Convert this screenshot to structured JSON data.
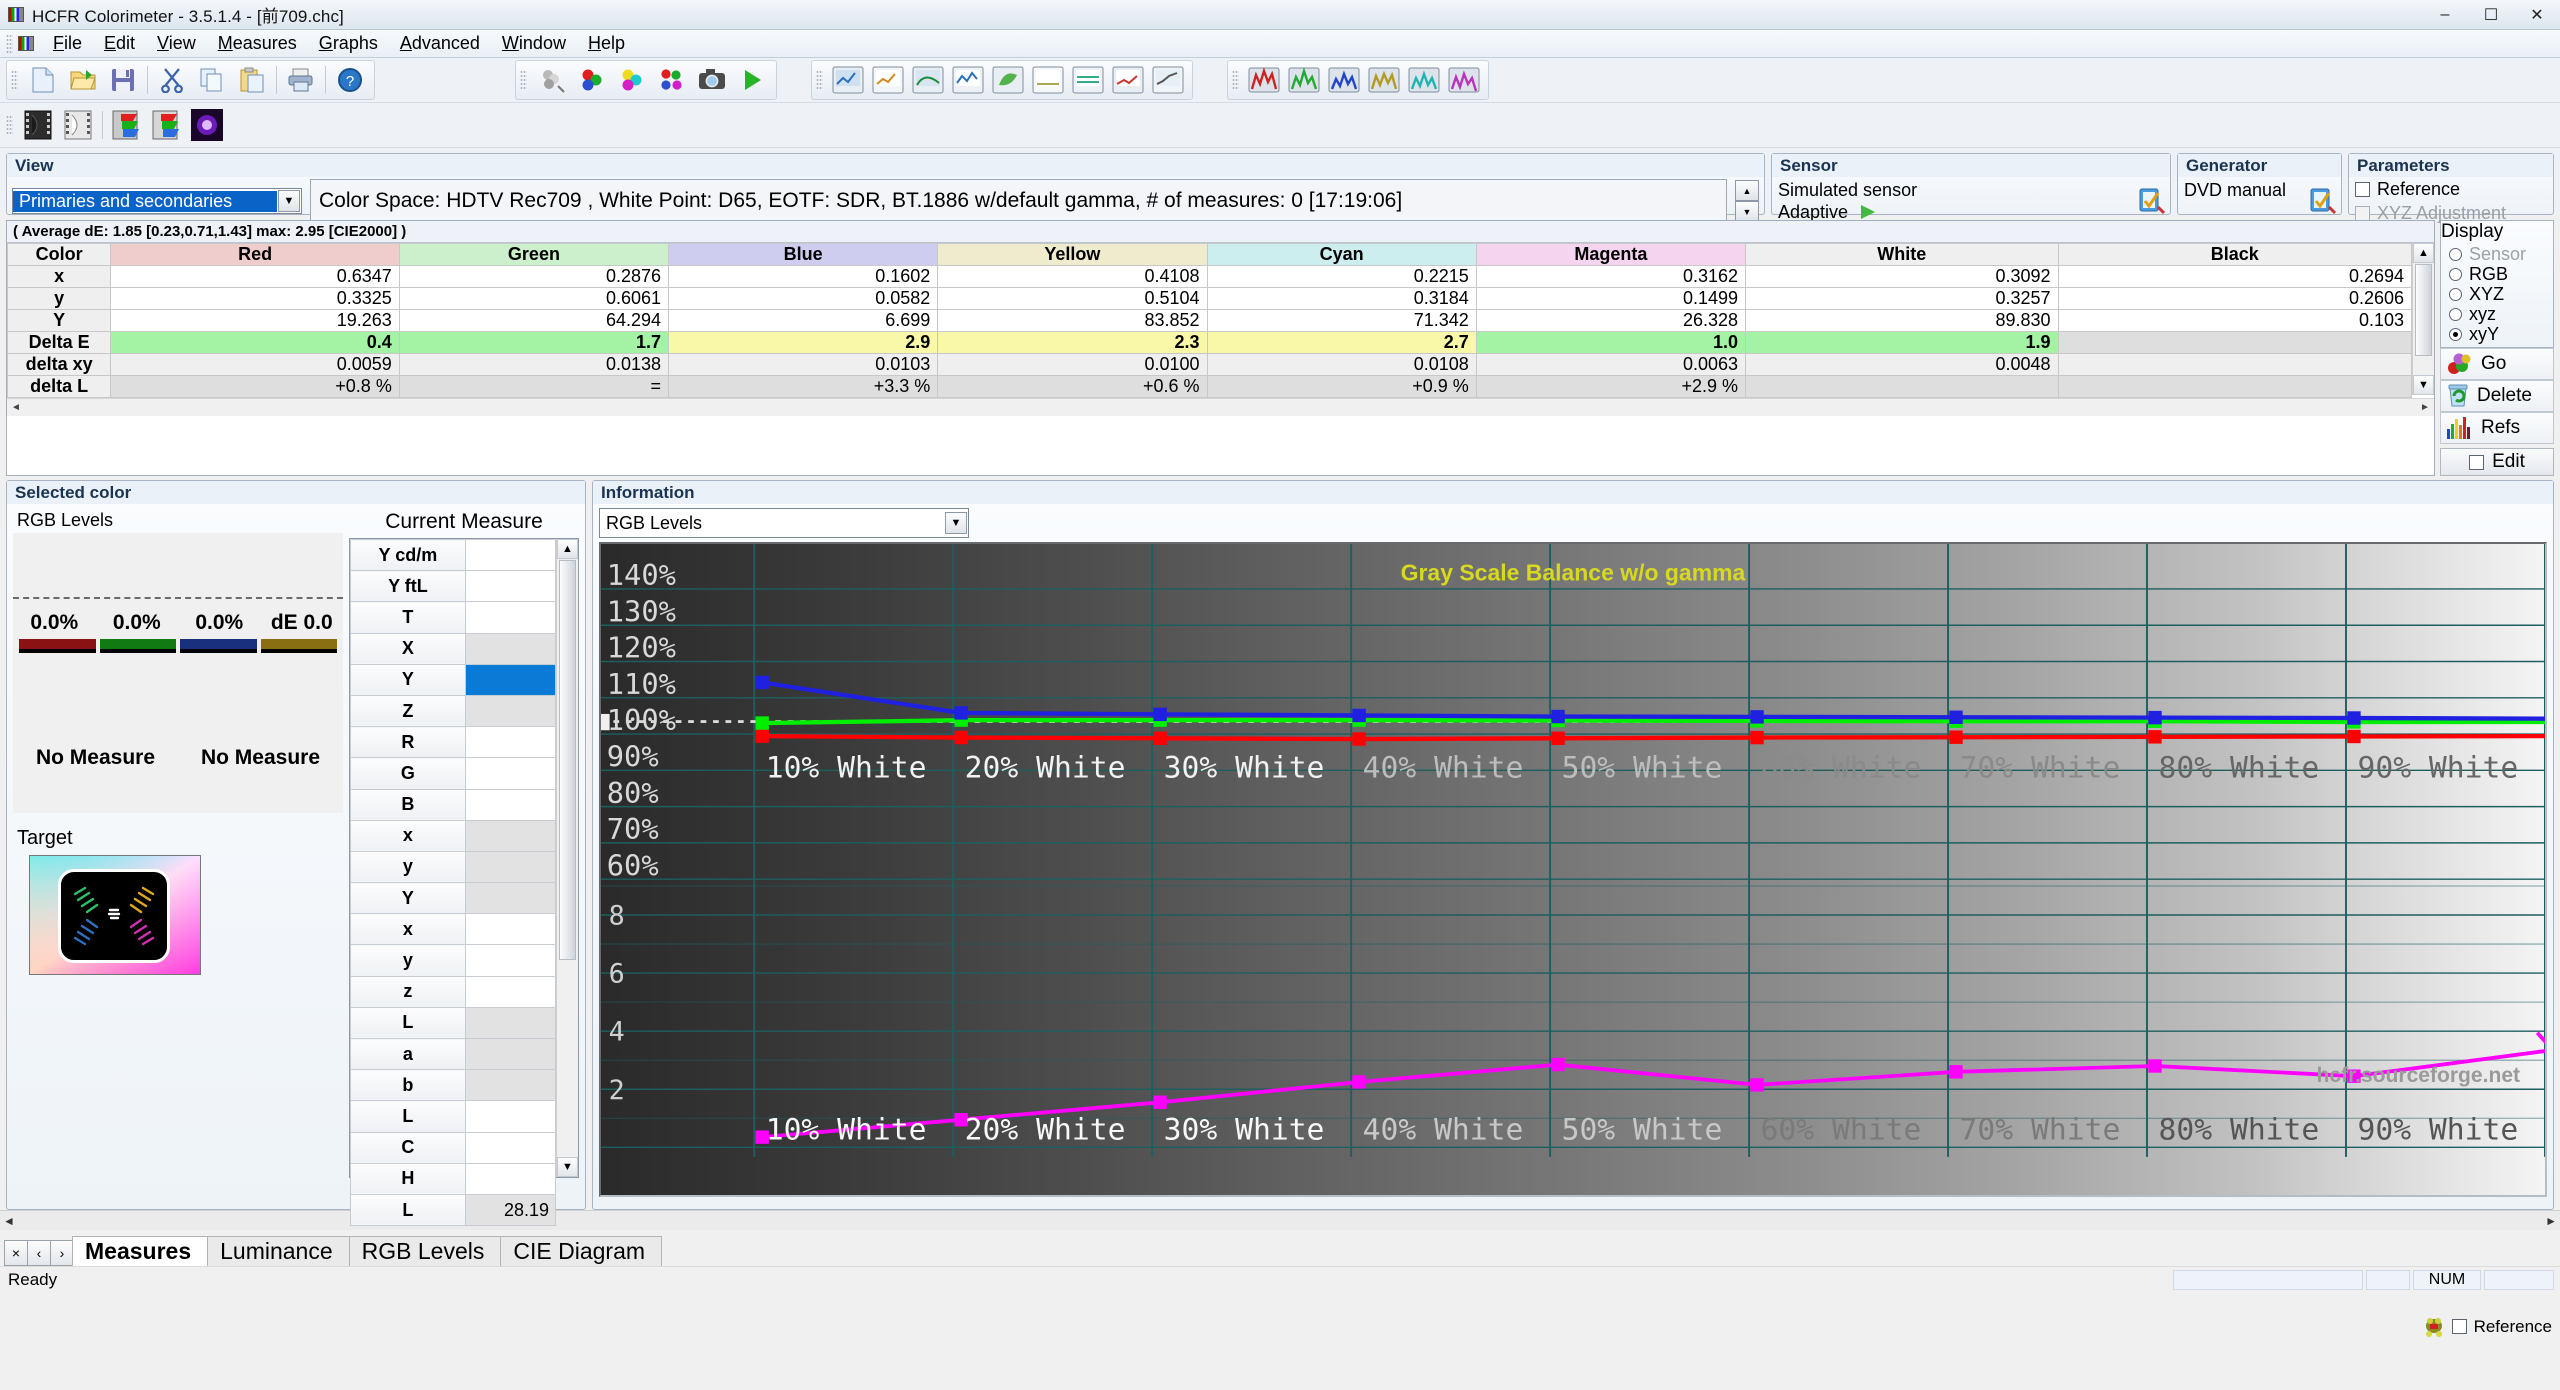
{
  "window": {
    "title": "HCFR Colorimeter - 3.5.1.4 - [前709.chc]",
    "minimize": "–",
    "maximize": "☐",
    "close": "✕"
  },
  "menu": [
    "File",
    "Edit",
    "View",
    "Measures",
    "Graphs",
    "Advanced",
    "Window",
    "Help"
  ],
  "toolbar": {
    "group1": [
      "new-icon",
      "open-icon",
      "save-icon",
      "cut-icon",
      "copy-icon",
      "paste-icon",
      "print-icon",
      "help-icon"
    ],
    "group2": [
      "target-icon",
      "rgb-balls-icon",
      "cmy-balls-icon",
      "rgbcmy-balls-icon",
      "camera-icon",
      "play-icon"
    ],
    "group3": [
      "graph1-icon",
      "graph2-icon",
      "graph3-icon",
      "graph4-icon",
      "graph5-icon",
      "graph6-icon",
      "graph7-icon",
      "graph8-icon",
      "graph9-icon"
    ],
    "group4": [
      "ref1-icon",
      "ref2-icon",
      "ref3-icon",
      "ref4-icon",
      "ref5-icon",
      "ref6-icon"
    ],
    "group5": [
      "film-dark-icon",
      "film-light-icon",
      "film-rgb-icon",
      "film-rgb2-icon",
      "flare-icon"
    ]
  },
  "view": {
    "title": "View",
    "combo_value": "Primaries and secondaries",
    "color_space": "Color Space: HDTV Rec709 , White Point: D65, EOTF:  SDR, BT.1886 w/default gamma, # of measures: 0 [17:19:06]"
  },
  "sensor": {
    "title": "Sensor",
    "line1": "Simulated sensor",
    "line2": "Adaptive"
  },
  "generator": {
    "title": "Generator",
    "line1": "DVD manual"
  },
  "parameters": {
    "title": "Parameters",
    "reference": "Reference",
    "xyz_adjustment": "XYZ Adjustment"
  },
  "display": {
    "title": "Display",
    "options": [
      "Sensor",
      "RGB",
      "XYZ",
      "xyz",
      "xyY"
    ],
    "selected": "xyY",
    "disabled": [
      "Sensor"
    ],
    "buttons": [
      "Go",
      "Delete",
      "Refs"
    ],
    "edit": "Edit"
  },
  "measures_table": {
    "average_line": "( Average dE: 1.85 [0.23,0.71,1.43] max: 2.95 [CIE2000] )",
    "columns": [
      "Color",
      "Red",
      "Green",
      "Blue",
      "Yellow",
      "Cyan",
      "Magenta",
      "White",
      "Black"
    ],
    "rows": [
      {
        "label": "x",
        "values": [
          "0.6347",
          "0.2876",
          "0.1602",
          "0.4108",
          "0.2215",
          "0.3162",
          "0.3092",
          "0.2694"
        ]
      },
      {
        "label": "y",
        "values": [
          "0.3325",
          "0.6061",
          "0.0582",
          "0.5104",
          "0.3184",
          "0.1499",
          "0.3257",
          "0.2606"
        ]
      },
      {
        "label": "Y",
        "values": [
          "19.263",
          "64.294",
          "6.699",
          "83.852",
          "71.342",
          "26.328",
          "89.830",
          "0.103"
        ]
      },
      {
        "label": "Delta E",
        "values": [
          "0.4",
          "1.7",
          "2.9",
          "2.3",
          "2.7",
          "1.0",
          "1.9",
          ""
        ]
      },
      {
        "label": "delta xy",
        "values": [
          "0.0059",
          "0.0138",
          "0.0103",
          "0.0100",
          "0.0108",
          "0.0063",
          "0.0048",
          ""
        ]
      },
      {
        "label": "delta L",
        "values": [
          "+0.8 %",
          "=",
          "+3.3 %",
          "+0.6 %",
          "+0.9 %",
          "+2.9 %",
          "",
          ""
        ]
      }
    ]
  },
  "selected_color": {
    "title": "Selected color",
    "rgb_levels_label": "RGB Levels",
    "percents": [
      "0.0%",
      "0.0%",
      "0.0%",
      "dE 0.0"
    ],
    "no_measure": [
      "No Measure",
      "No Measure"
    ],
    "target_label": "Target",
    "current_measure_title": "Current Measure",
    "rows": [
      {
        "label": "Y cd/m",
        "value": "",
        "style": "white"
      },
      {
        "label": "Y ftL",
        "value": "",
        "style": "white"
      },
      {
        "label": "T",
        "value": "",
        "style": "white"
      },
      {
        "label": "X",
        "value": "",
        "style": "gray"
      },
      {
        "label": "Y",
        "value": "",
        "style": "sel"
      },
      {
        "label": "Z",
        "value": "",
        "style": "gray"
      },
      {
        "label": "R",
        "value": "",
        "style": "white"
      },
      {
        "label": "G",
        "value": "",
        "style": "white"
      },
      {
        "label": "B",
        "value": "",
        "style": "white"
      },
      {
        "label": "x",
        "value": "",
        "style": "gray"
      },
      {
        "label": "y",
        "value": "",
        "style": "gray"
      },
      {
        "label": "Y",
        "value": "",
        "style": "gray"
      },
      {
        "label": "x",
        "value": "",
        "style": "white"
      },
      {
        "label": "y",
        "value": "",
        "style": "white"
      },
      {
        "label": "z",
        "value": "",
        "style": "white"
      },
      {
        "label": "L",
        "value": "",
        "style": "gray"
      },
      {
        "label": "a",
        "value": "",
        "style": "gray"
      },
      {
        "label": "b",
        "value": "",
        "style": "gray"
      },
      {
        "label": "L",
        "value": "",
        "style": "white"
      },
      {
        "label": "C",
        "value": "",
        "style": "white"
      },
      {
        "label": "H",
        "value": "",
        "style": "white"
      },
      {
        "label": "L",
        "value": "28.19",
        "style": "gray"
      }
    ]
  },
  "information": {
    "title": "Information",
    "combo_value": "RGB Levels"
  },
  "chart_data": {
    "type": "line",
    "title": "Gray Scale Balance w/o gamma",
    "watermark": "hcfr.sourceforge.net",
    "categories": [
      "10% White",
      "20% White",
      "30% White",
      "40% White",
      "50% White",
      "60% White",
      "70% White",
      "80% White",
      "90% White"
    ],
    "ylabel": "",
    "xlabel": "",
    "ylim_top": [
      60,
      145
    ],
    "yticks_top": [
      "140%",
      "130%",
      "120%",
      "110%",
      "100%",
      "90%",
      "80%",
      "70%",
      "60%"
    ],
    "yticks_bottom": [
      "8",
      "6",
      "4",
      "2"
    ],
    "ylim_bottom": [
      0,
      9.4
    ],
    "reference_line": 100,
    "grid": true,
    "legend": "none",
    "series": [
      {
        "name": "Red",
        "color": "#ff0000",
        "values": [
          96.0,
          95.6,
          95.4,
          95.2,
          95.4,
          95.6,
          95.7,
          95.8,
          95.9,
          96.0
        ]
      },
      {
        "name": "Green",
        "color": "#00ee00",
        "values": [
          99.6,
          100.4,
          100.4,
          100.4,
          100.3,
          100.2,
          100.1,
          100.1,
          99.9,
          99.9
        ]
      },
      {
        "name": "Blue",
        "color": "#2020e0",
        "values": [
          110.8,
          102.4,
          102.0,
          101.7,
          101.4,
          101.3,
          101.2,
          101.1,
          101.0,
          100.8
        ]
      },
      {
        "name": "dE",
        "color": "#ff00ff",
        "values": [
          0.35,
          0.95,
          1.55,
          2.25,
          2.85,
          2.15,
          2.6,
          2.8,
          2.45,
          3.35
        ]
      }
    ]
  },
  "tabs": {
    "nav": [
      "×",
      "‹",
      "›"
    ],
    "items": [
      "Measures",
      "Luminance",
      "RGB Levels",
      "CIE Diagram"
    ],
    "active": "Measures"
  },
  "statusbar": {
    "text": "Ready",
    "num": "NUM",
    "reference": "Reference"
  },
  "colors": {
    "header_red": "#f0cdcd",
    "header_green": "#ccefcc",
    "header_blue": "#cfcdef",
    "header_yellow": "#eeeccc",
    "header_cyan": "#cceeee",
    "header_magenta": "#f4d4ef",
    "header_plain": "#efefef",
    "de_good": "#a4f2a4",
    "de_warn": "#f8f8a8",
    "accent_blue": "#0a64c8"
  }
}
